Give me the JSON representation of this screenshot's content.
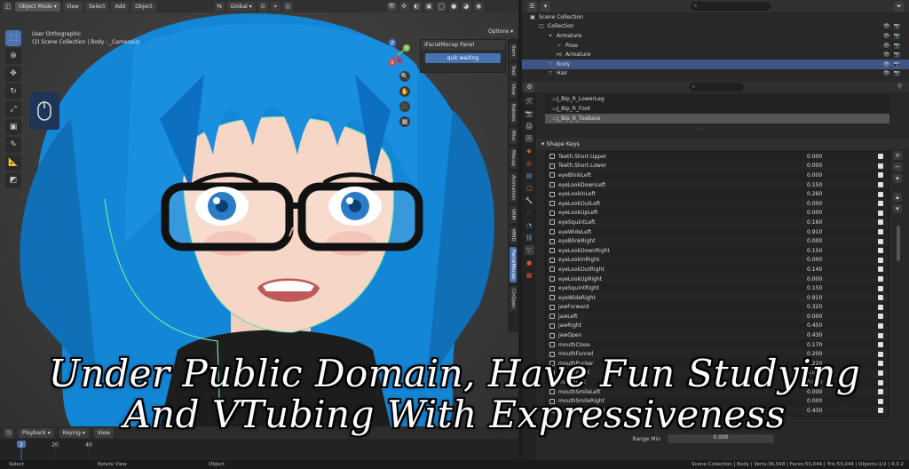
{
  "header": {
    "mode": "Object Mode",
    "menus": [
      "View",
      "Select",
      "Add",
      "Object"
    ],
    "transform_orientation": "Global",
    "options_label": "Options"
  },
  "viewport": {
    "view_name": "User Orthographic",
    "collection_info": "(2) Scene Collection | Body : _CameraUp",
    "gizmo_axes": [
      "Z",
      "Y",
      "X"
    ]
  },
  "mocap_panel": {
    "title": "iFacialMocap Panel",
    "button": "quit waiting"
  },
  "viewport_tabs": [
    "Item",
    "Tool",
    "View",
    "Rokoko",
    "Misc",
    "Mocap",
    "Animation",
    "VRM",
    "MMD",
    "FacialMocap",
    "CinSpec"
  ],
  "viewport_tabs_active": "FacialMocap",
  "timeline": {
    "menus": [
      "Playback",
      "Keying",
      "View"
    ],
    "current_frame": "2",
    "ticks": [
      "20",
      "40"
    ]
  },
  "status": {
    "left": [
      "Select",
      "Rotate View",
      "Object"
    ],
    "right": "Scene Collection | Body | Verts:36,548 | Faces:53,044 | Tris:53,044 | Objects:1/2 | 4.0.2"
  },
  "outliner": {
    "rows": [
      {
        "label": "Scene Collection",
        "indent": 0,
        "icon": "scene-collection-icon"
      },
      {
        "label": "Collection",
        "indent": 1,
        "icon": "collection-icon"
      },
      {
        "label": "Armature",
        "indent": 2,
        "icon": "armature-icon"
      },
      {
        "label": "Pose",
        "indent": 3,
        "icon": "pose-icon"
      },
      {
        "label": "Armature",
        "indent": 3,
        "icon": "armature-data-icon"
      },
      {
        "label": "Body",
        "indent": 2,
        "icon": "mesh-icon",
        "selected": true
      },
      {
        "label": "Hair",
        "indent": 2,
        "icon": "mesh-icon"
      }
    ]
  },
  "bones": {
    "rows": [
      {
        "label": "J_Bip_R_LowerLeg"
      },
      {
        "label": "J_Bip_R_Foot"
      },
      {
        "label": "J_Bip_R_ToeBase",
        "selected": true
      }
    ]
  },
  "shape_keys": {
    "title": "Shape Keys",
    "items": [
      {
        "name": "Teeth.Short.Upper",
        "value": "0.000"
      },
      {
        "name": "Teeth.Short.Lower",
        "value": "0.000"
      },
      {
        "name": "eyeBlinkLeft",
        "value": "0.000"
      },
      {
        "name": "eyeLookDownLeft",
        "value": "0.150"
      },
      {
        "name": "eyeLookInLeft",
        "value": "0.260"
      },
      {
        "name": "eyeLookOutLeft",
        "value": "0.000"
      },
      {
        "name": "eyeLookUpLeft",
        "value": "0.000"
      },
      {
        "name": "eyeSquintLeft",
        "value": "0.160"
      },
      {
        "name": "eyeWideLeft",
        "value": "0.910"
      },
      {
        "name": "eyeBlinkRight",
        "value": "0.000"
      },
      {
        "name": "eyeLookDownRight",
        "value": "0.150"
      },
      {
        "name": "eyeLookInRight",
        "value": "0.000"
      },
      {
        "name": "eyeLookOutRight",
        "value": "0.140"
      },
      {
        "name": "eyeLookUpRight",
        "value": "0.000"
      },
      {
        "name": "eyeSquintRight",
        "value": "0.150"
      },
      {
        "name": "eyeWideRight",
        "value": "0.910"
      },
      {
        "name": "jawForward",
        "value": "0.320"
      },
      {
        "name": "jawLeft",
        "value": "0.000"
      },
      {
        "name": "jawRight",
        "value": "0.450"
      },
      {
        "name": "jawOpen",
        "value": "0.430"
      },
      {
        "name": "mouthClose",
        "value": "0.170"
      },
      {
        "name": "mouthFunnel",
        "value": "0.200"
      },
      {
        "name": "mouthPucker",
        "value": "0.220"
      },
      {
        "name": "mouthRight",
        "value": "0.000"
      },
      {
        "name": "mouthLeft",
        "value": "0.000"
      },
      {
        "name": "mouthSmileLeft",
        "value": "0.000"
      },
      {
        "name": "mouthSmileRight",
        "value": "0.000"
      },
      {
        "name": "mouthFrownRight",
        "value": "0.430"
      }
    ],
    "bottom_field": "Range Min",
    "bottom_value": "0.000"
  },
  "caption": {
    "line1": "Under Public Domain, Have Fun Studying",
    "line2": "And VTubing With Expressiveness"
  },
  "colors": {
    "accent": "#4d73b0",
    "hair": "#1a8fe0",
    "selected_row": "#3e5585"
  }
}
